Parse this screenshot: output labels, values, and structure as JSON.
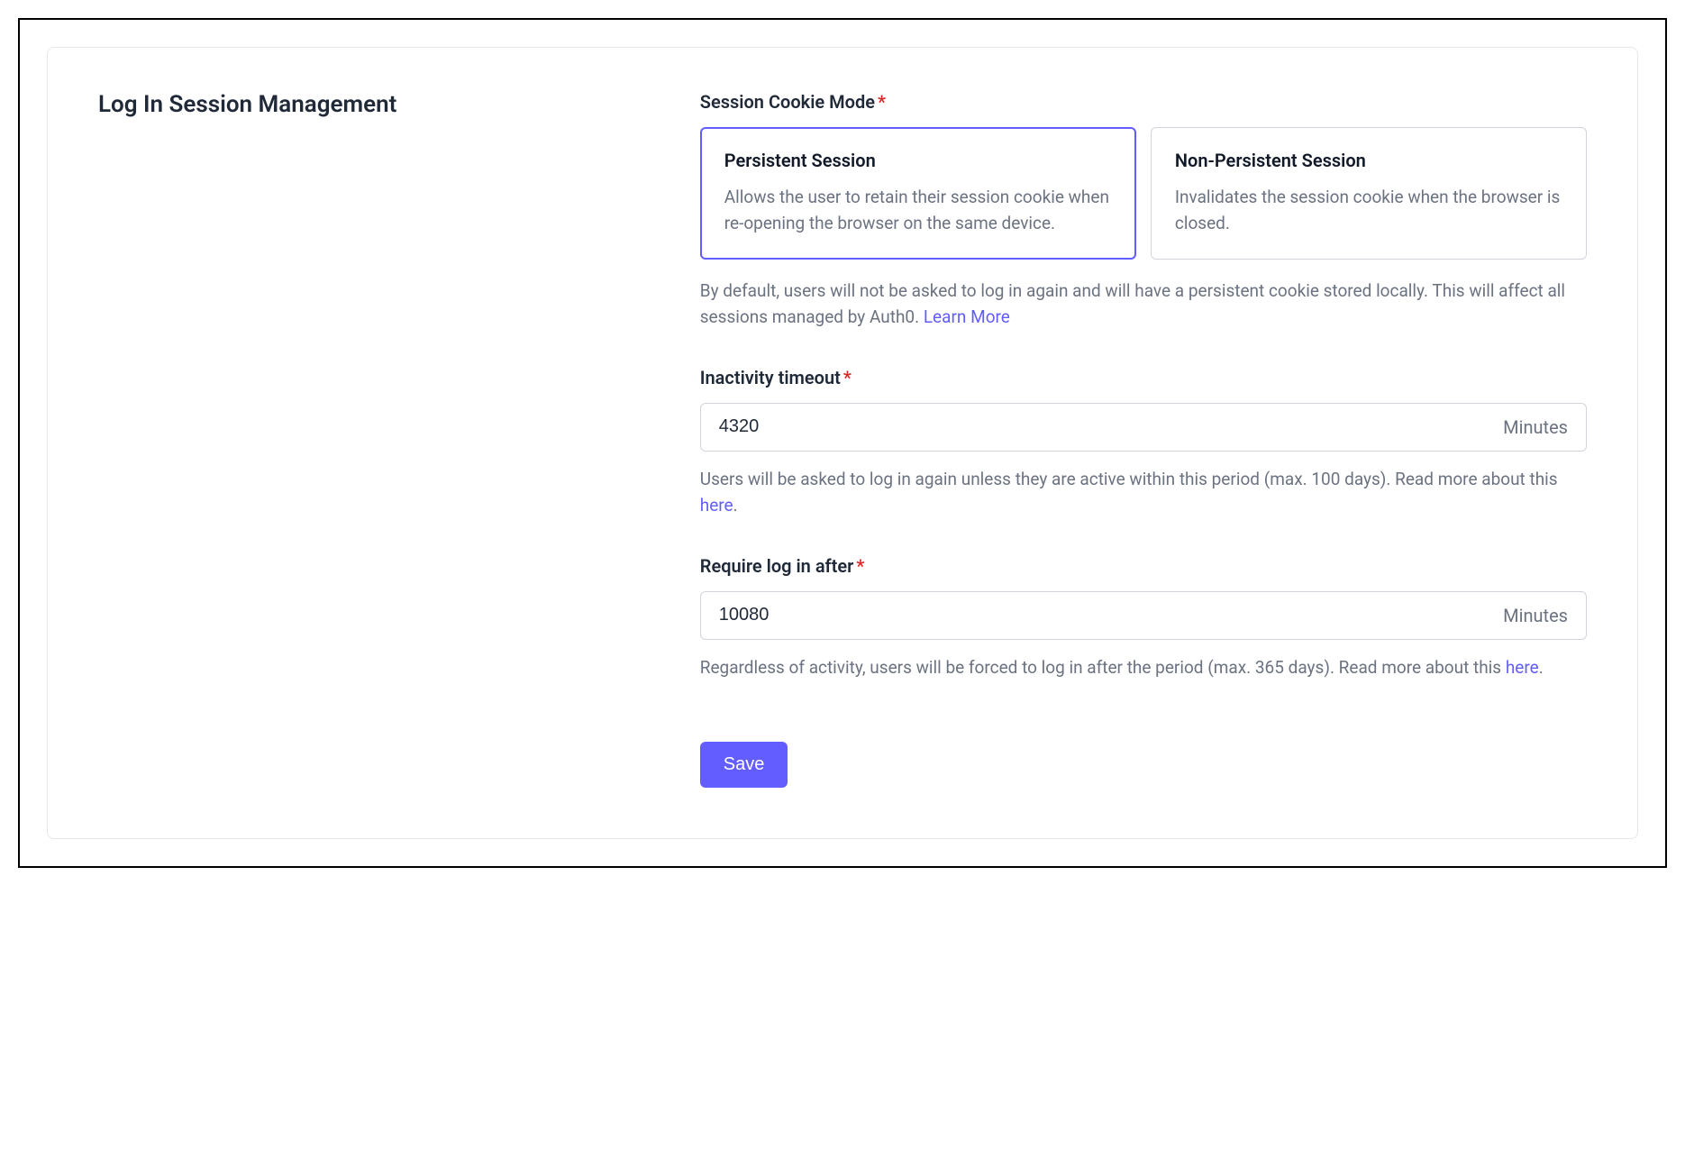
{
  "section": {
    "title": "Log In Session Management"
  },
  "cookie_mode": {
    "label": "Session Cookie Mode",
    "options": {
      "persistent": {
        "title": "Persistent Session",
        "desc": "Allows the user to retain their session cookie when re-opening the browser on the same device.",
        "selected": true
      },
      "non_persistent": {
        "title": "Non-Persistent Session",
        "desc": "Invalidates the session cookie when the browser is closed.",
        "selected": false
      }
    },
    "helper_prefix": "By default, users will not be asked to log in again and will have a persistent cookie stored locally. This will affect all sessions managed by Auth0. ",
    "helper_link": "Learn More"
  },
  "inactivity": {
    "label": "Inactivity timeout",
    "value": "4320",
    "unit": "Minutes",
    "helper_prefix": "Users will be asked to log in again unless they are active within this period (max. 100 days). Read more about this ",
    "helper_link": "here",
    "helper_suffix": "."
  },
  "require_login": {
    "label": "Require log in after",
    "value": "10080",
    "unit": "Minutes",
    "helper_prefix": "Regardless of activity, users will be forced to log in after the period (max. 365 days). Read more about this ",
    "helper_link": "here",
    "helper_suffix": "."
  },
  "actions": {
    "save": "Save"
  },
  "required_star": "*"
}
